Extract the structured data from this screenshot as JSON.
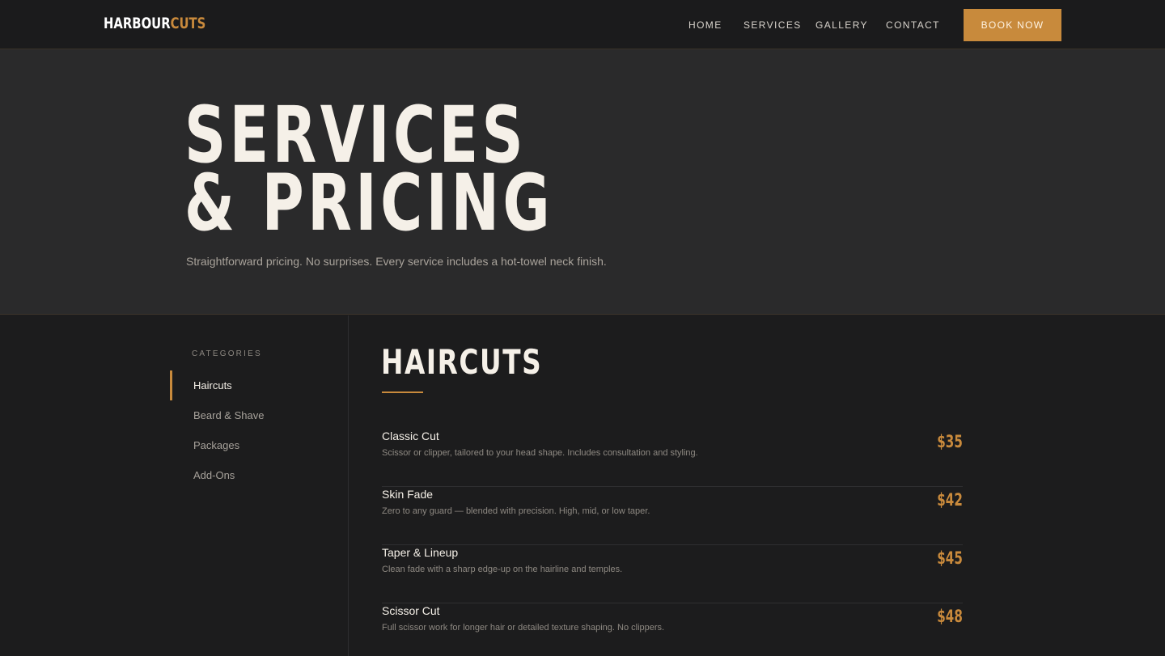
{
  "brand": {
    "part1": "HARBOUR",
    "part2": "CUTS"
  },
  "nav": {
    "links": [
      "HOME",
      "SERVICES",
      "GALLERY",
      "CONTACT"
    ],
    "cta": "BOOK NOW"
  },
  "hero": {
    "title_line1": "SERVICES",
    "title_line2": "& PRICING",
    "subtitle": "Straightforward pricing. No surprises. Every service includes a hot-towel neck finish."
  },
  "categories": {
    "heading": "CATEGORIES",
    "items": [
      "Haircuts",
      "Beard & Shave",
      "Packages",
      "Add-Ons"
    ],
    "active": "Haircuts"
  },
  "section": {
    "title": "HAIRCUTS",
    "services": [
      {
        "name": "Classic Cut",
        "desc": "Scissor or clipper, tailored to your head shape. Includes consultation and styling.",
        "price": "$35"
      },
      {
        "name": "Skin Fade",
        "desc": "Zero to any guard — blended with precision. High, mid, or low taper.",
        "price": "$42"
      },
      {
        "name": "Taper & Lineup",
        "desc": "Clean fade with a sharp edge-up on the hairline and temples.",
        "price": "$45"
      },
      {
        "name": "Scissor Cut",
        "desc": "Full scissor work for longer hair or detailed texture shaping. No clippers.",
        "price": "$48"
      }
    ]
  },
  "colors": {
    "accent": "#c88a3c",
    "background": "#1c1c1d",
    "hero_bg": "#2a2a2b"
  }
}
